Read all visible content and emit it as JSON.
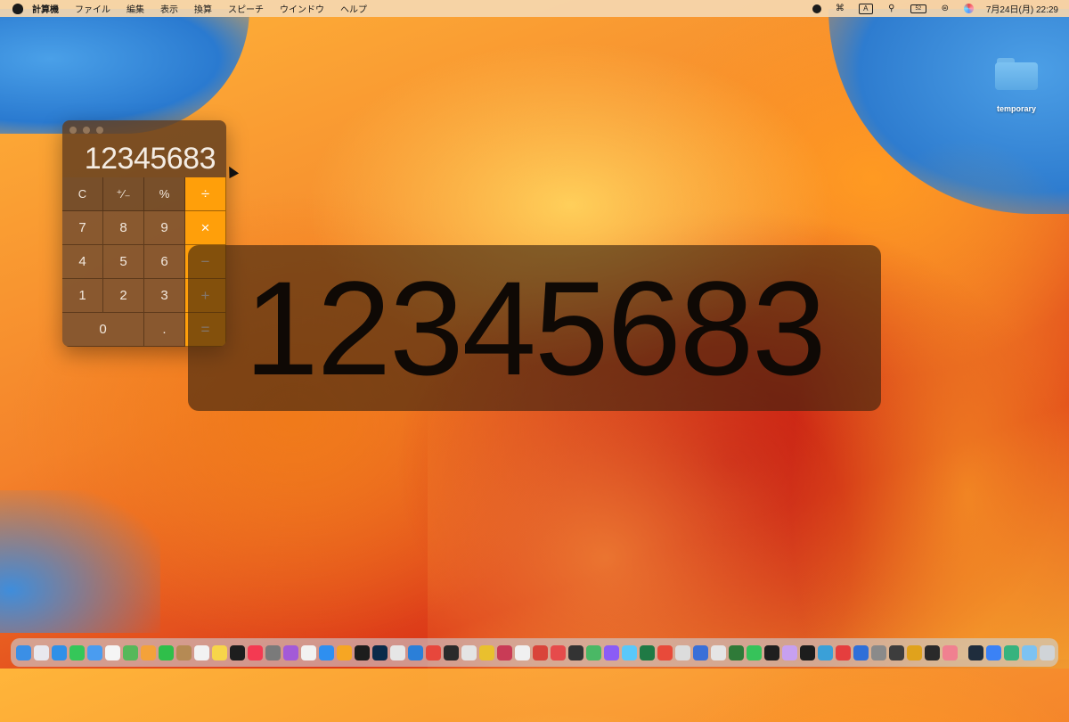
{
  "menubar": {
    "items": [
      "計算機",
      "ファイル",
      "編集",
      "表示",
      "換算",
      "スピーチ",
      "ウインドウ",
      "ヘルプ"
    ],
    "input_mode": "A",
    "battery": "52",
    "clock": "7月24日(月)  22:29"
  },
  "desktop": {
    "folder_label": "temporary"
  },
  "calculator": {
    "display": "12345683",
    "keys": [
      {
        "label": "C",
        "kind": "fn"
      },
      {
        "label": "⁺∕₋",
        "kind": "fn"
      },
      {
        "label": "%",
        "kind": "fn"
      },
      {
        "label": "÷",
        "kind": "op"
      },
      {
        "label": "7",
        "kind": "num"
      },
      {
        "label": "8",
        "kind": "num"
      },
      {
        "label": "9",
        "kind": "num"
      },
      {
        "label": "×",
        "kind": "op"
      },
      {
        "label": "4",
        "kind": "num"
      },
      {
        "label": "5",
        "kind": "num"
      },
      {
        "label": "6",
        "kind": "num"
      },
      {
        "label": "−",
        "kind": "op"
      },
      {
        "label": "1",
        "kind": "num"
      },
      {
        "label": "2",
        "kind": "num"
      },
      {
        "label": "3",
        "kind": "num"
      },
      {
        "label": "+",
        "kind": "op"
      },
      {
        "label": "0",
        "kind": "zero"
      },
      {
        "label": ".",
        "kind": "num"
      },
      {
        "label": "=",
        "kind": "op"
      }
    ]
  },
  "large_type": {
    "text": "12345683"
  },
  "dock": {
    "apps": [
      {
        "icon": "finder-icon",
        "color": "#3b8fe6"
      },
      {
        "icon": "launchpad-icon",
        "color": "#e8e8ee"
      },
      {
        "icon": "safari-icon",
        "color": "#2f90e8"
      },
      {
        "icon": "messages-icon",
        "color": "#35c759"
      },
      {
        "icon": "mail-icon",
        "color": "#4a9cf0"
      },
      {
        "icon": "calendar-icon",
        "color": "#f5f5f5"
      },
      {
        "icon": "maps-icon",
        "color": "#56b85a"
      },
      {
        "icon": "photos-icon",
        "color": "#f4a23a"
      },
      {
        "icon": "facetime-icon",
        "color": "#2fbf4a"
      },
      {
        "icon": "contacts-icon",
        "color": "#b58a54"
      },
      {
        "icon": "reminders-icon",
        "color": "#f2f2f2"
      },
      {
        "icon": "notes-icon",
        "color": "#f7d54a"
      },
      {
        "icon": "tv-icon",
        "color": "#1e1e1e"
      },
      {
        "icon": "music-icon",
        "color": "#f43a52"
      },
      {
        "icon": "system-settings-icon",
        "color": "#7a7a7a"
      },
      {
        "icon": "podcasts-icon",
        "color": "#a35ad8"
      },
      {
        "icon": "news-icon",
        "color": "#f2f2f2"
      },
      {
        "icon": "app-store-icon",
        "color": "#2e8ff0"
      },
      {
        "icon": "pencil-icon",
        "color": "#f6a623"
      },
      {
        "icon": "chatgpt-icon",
        "color": "#1d1d1d"
      },
      {
        "icon": "photoshop-icon",
        "color": "#0b2a4a"
      },
      {
        "icon": "quill-icon",
        "color": "#e6e6e6"
      },
      {
        "icon": "xcode-icon",
        "color": "#2b7fd8"
      },
      {
        "icon": "rocket-icon",
        "color": "#e7473c"
      },
      {
        "icon": "terminal-icon",
        "color": "#2a2a2a"
      },
      {
        "icon": "pen-icon",
        "color": "#e4e4e4"
      },
      {
        "icon": "chrome-icon",
        "color": "#e9c02e"
      },
      {
        "icon": "camera-icon",
        "color": "#c93b56"
      },
      {
        "icon": "bird-icon",
        "color": "#f0f0f0"
      },
      {
        "icon": "target-icon",
        "color": "#d9443a"
      },
      {
        "icon": "drop-icon",
        "color": "#e64b4b"
      },
      {
        "icon": "monitor-icon",
        "color": "#333333"
      },
      {
        "icon": "shield-icon",
        "color": "#4ab865"
      },
      {
        "icon": "messenger-icon",
        "color": "#8b5cf6"
      },
      {
        "icon": "finder-window-icon",
        "color": "#5ac8fa"
      },
      {
        "icon": "excel-icon",
        "color": "#1f7a45"
      },
      {
        "icon": "triangle-icon",
        "color": "#e84a3a"
      },
      {
        "icon": "printer-icon",
        "color": "#dcdcdc"
      },
      {
        "icon": "keyboard-icon",
        "color": "#3a6fd8"
      },
      {
        "icon": "cat-icon",
        "color": "#e5e5e5"
      },
      {
        "icon": "grid-icon",
        "color": "#2f7a38"
      },
      {
        "icon": "line-icon",
        "color": "#36c35a"
      },
      {
        "icon": "globe-icon",
        "color": "#1f1f1f"
      },
      {
        "icon": "puzzle-icon",
        "color": "#c7a0f0"
      },
      {
        "icon": "xit-icon",
        "color": "#1d1d1d"
      },
      {
        "icon": "spiral-icon",
        "color": "#3aa0d8"
      },
      {
        "icon": "chrome-alt-icon",
        "color": "#e53e3e"
      },
      {
        "icon": "browser-icon",
        "color": "#2f6fd8"
      },
      {
        "icon": "gray-box-icon",
        "color": "#8a8a8a"
      },
      {
        "icon": "phone-icon",
        "color": "#3d3d3d"
      },
      {
        "icon": "v-icon",
        "color": "#e0a21c"
      },
      {
        "icon": "display-icon",
        "color": "#2a2a2a"
      },
      {
        "icon": "timer-icon",
        "color": "#f08090"
      }
    ],
    "trailing": [
      {
        "icon": "cube-icon",
        "color": "#1f2d3d"
      },
      {
        "icon": "window-icon",
        "color": "#3b82f6"
      },
      {
        "icon": "earth-icon",
        "color": "#36b37e"
      },
      {
        "icon": "downloads-folder-icon",
        "color": "#7cc2f2"
      },
      {
        "icon": "trash-icon",
        "color": "#d0d4d8"
      }
    ]
  }
}
